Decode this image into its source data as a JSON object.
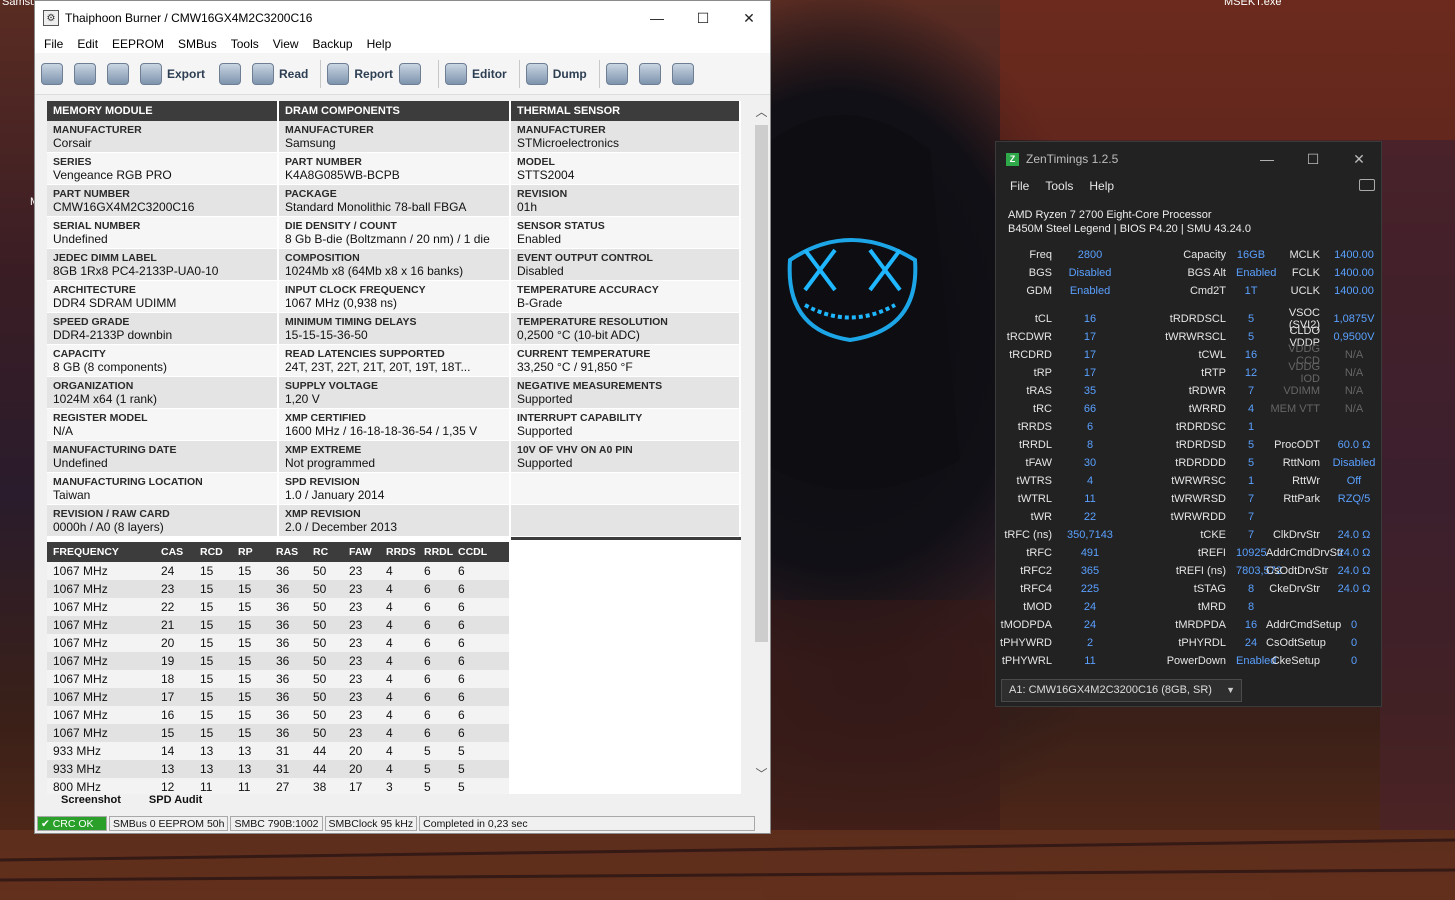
{
  "desktop": {
    "top_left_label": "Samsung Magician",
    "top_right_label": "MSEKT.exe",
    "left_stub_label": "M"
  },
  "thaiphoon": {
    "title": "Thaiphoon Burner / CMW16GX4M2C3200C16",
    "window_buttons": {
      "minimize": "—",
      "maximize": "☐",
      "close": "✕"
    },
    "menu": [
      "File",
      "Edit",
      "EEPROM",
      "SMBus",
      "Tools",
      "View",
      "Backup",
      "Help"
    ],
    "toolbar": {
      "export": "Export",
      "read": "Read",
      "report": "Report",
      "editor": "Editor",
      "dump": "Dump"
    },
    "memory_module": {
      "header": "MEMORY MODULE",
      "items": [
        {
          "label": "MANUFACTURER",
          "value": "Corsair"
        },
        {
          "label": "SERIES",
          "value": "Vengeance RGB PRO"
        },
        {
          "label": "PART NUMBER",
          "value": "CMW16GX4M2C3200C16"
        },
        {
          "label": "SERIAL NUMBER",
          "value": "Undefined"
        },
        {
          "label": "JEDEC DIMM LABEL",
          "value": "8GB 1Rx8 PC4-2133P-UA0-10"
        },
        {
          "label": "ARCHITECTURE",
          "value": "DDR4 SDRAM UDIMM"
        },
        {
          "label": "SPEED GRADE",
          "value": "DDR4-2133P downbin"
        },
        {
          "label": "CAPACITY",
          "value": "8 GB (8 components)"
        },
        {
          "label": "ORGANIZATION",
          "value": "1024M x64 (1 rank)"
        },
        {
          "label": "REGISTER MODEL",
          "value": "N/A"
        },
        {
          "label": "MANUFACTURING DATE",
          "value": "Undefined"
        },
        {
          "label": "MANUFACTURING LOCATION",
          "value": "Taiwan"
        },
        {
          "label": "REVISION / RAW CARD",
          "value": "0000h / A0 (8 layers)"
        }
      ]
    },
    "dram_components": {
      "header": "DRAM COMPONENTS",
      "items": [
        {
          "label": "MANUFACTURER",
          "value": "Samsung"
        },
        {
          "label": "PART NUMBER",
          "value": "K4A8G085WB-BCPB"
        },
        {
          "label": "PACKAGE",
          "value": "Standard Monolithic 78-ball FBGA"
        },
        {
          "label": "DIE DENSITY / COUNT",
          "value": "8 Gb B-die (Boltzmann / 20 nm) / 1 die"
        },
        {
          "label": "COMPOSITION",
          "value": "1024Mb x8 (64Mb x8 x 16 banks)"
        },
        {
          "label": "INPUT CLOCK FREQUENCY",
          "value": "1067 MHz (0,938 ns)"
        },
        {
          "label": "MINIMUM TIMING DELAYS",
          "value": "15-15-15-36-50"
        },
        {
          "label": "READ LATENCIES SUPPORTED",
          "value": "24T, 23T, 22T, 21T, 20T, 19T, 18T..."
        },
        {
          "label": "SUPPLY VOLTAGE",
          "value": "1,20 V"
        },
        {
          "label": "XMP CERTIFIED",
          "value": "1600 MHz / 16-18-18-36-54 / 1,35 V"
        },
        {
          "label": "XMP EXTREME",
          "value": "Not programmed"
        },
        {
          "label": "SPD REVISION",
          "value": "1.0 / January 2014"
        },
        {
          "label": "XMP REVISION",
          "value": "2.0 / December 2013"
        }
      ]
    },
    "thermal_sensor": {
      "header": "THERMAL SENSOR",
      "items": [
        {
          "label": "MANUFACTURER",
          "value": "STMicroelectronics"
        },
        {
          "label": "MODEL",
          "value": "STTS2004"
        },
        {
          "label": "REVISION",
          "value": "01h"
        },
        {
          "label": "SENSOR STATUS",
          "value": "Enabled"
        },
        {
          "label": "EVENT OUTPUT CONTROL",
          "value": "Disabled"
        },
        {
          "label": "TEMPERATURE ACCURACY",
          "value": "B-Grade"
        },
        {
          "label": "TEMPERATURE RESOLUTION",
          "value": "0,2500 °C (10-bit ADC)"
        },
        {
          "label": "CURRENT TEMPERATURE",
          "value": "33,250 °C / 91,850 °F"
        },
        {
          "label": "NEGATIVE MEASUREMENTS",
          "value": "Supported"
        },
        {
          "label": "INTERRUPT CAPABILITY",
          "value": "Supported"
        },
        {
          "label": "10V OF VHV ON A0 PIN",
          "value": "Supported"
        },
        {
          "label": "",
          "value": ""
        },
        {
          "label": "",
          "value": ""
        }
      ]
    },
    "timing_table": {
      "headers": [
        "FREQUENCY",
        "CAS",
        "RCD",
        "RP",
        "RAS",
        "RC",
        "FAW",
        "RRDS",
        "RRDL",
        "CCDL"
      ],
      "rows": [
        [
          "1067 MHz",
          "24",
          "15",
          "15",
          "36",
          "50",
          "23",
          "4",
          "6",
          "6"
        ],
        [
          "1067 MHz",
          "23",
          "15",
          "15",
          "36",
          "50",
          "23",
          "4",
          "6",
          "6"
        ],
        [
          "1067 MHz",
          "22",
          "15",
          "15",
          "36",
          "50",
          "23",
          "4",
          "6",
          "6"
        ],
        [
          "1067 MHz",
          "21",
          "15",
          "15",
          "36",
          "50",
          "23",
          "4",
          "6",
          "6"
        ],
        [
          "1067 MHz",
          "20",
          "15",
          "15",
          "36",
          "50",
          "23",
          "4",
          "6",
          "6"
        ],
        [
          "1067 MHz",
          "19",
          "15",
          "15",
          "36",
          "50",
          "23",
          "4",
          "6",
          "6"
        ],
        [
          "1067 MHz",
          "18",
          "15",
          "15",
          "36",
          "50",
          "23",
          "4",
          "6",
          "6"
        ],
        [
          "1067 MHz",
          "17",
          "15",
          "15",
          "36",
          "50",
          "23",
          "4",
          "6",
          "6"
        ],
        [
          "1067 MHz",
          "16",
          "15",
          "15",
          "36",
          "50",
          "23",
          "4",
          "6",
          "6"
        ],
        [
          "1067 MHz",
          "15",
          "15",
          "15",
          "36",
          "50",
          "23",
          "4",
          "6",
          "6"
        ],
        [
          "933 MHz",
          "14",
          "13",
          "13",
          "31",
          "44",
          "20",
          "4",
          "5",
          "5"
        ],
        [
          "933 MHz",
          "13",
          "13",
          "13",
          "31",
          "44",
          "20",
          "4",
          "5",
          "5"
        ],
        [
          "800 MHz",
          "12",
          "11",
          "11",
          "27",
          "38",
          "17",
          "3",
          "5",
          "5"
        ]
      ]
    },
    "bottom_buttons": {
      "screenshot": "Screenshot",
      "spd_audit": "SPD Audit"
    },
    "status": {
      "crc": "✔ CRC OK",
      "smbus": "SMBus 0 EEPROM 50h",
      "smbc": "SMBC 790B:1002",
      "smbclock": "SMBClock 95 kHz",
      "completed": "Completed in 0,23 sec"
    },
    "colors": {
      "header_bg": "#3c3c3c",
      "crc_ok": "#2aa02a"
    }
  },
  "zentimings": {
    "title": "ZenTimings 1.2.5",
    "window_buttons": {
      "minimize": "—",
      "maximize": "☐",
      "close": "✕"
    },
    "menu": [
      "File",
      "Tools",
      "Help"
    ],
    "cpu": "AMD Ryzen 7 2700 Eight-Core Processor",
    "board": "B450M Steel Legend | BIOS P4.20 | SMU 43.24.0",
    "group1": [
      [
        "Freq",
        "2800",
        "Capacity",
        "16GB",
        "MCLK",
        "1400.00"
      ],
      [
        "BGS",
        "Disabled",
        "BGS Alt",
        "Enabled",
        "FCLK",
        "1400.00"
      ],
      [
        "GDM",
        "Enabled",
        "Cmd2T",
        "1T",
        "UCLK",
        "1400.00"
      ]
    ],
    "group2": [
      [
        "tCL",
        "16",
        "tRDRDSCL",
        "5",
        "VSOC (SVI2)",
        "1,0875V"
      ],
      [
        "tRCDWR",
        "17",
        "tWRWRSCL",
        "5",
        "CLDO VDDP",
        "0,9500V"
      ],
      [
        "tRCDRD",
        "17",
        "tCWL",
        "16",
        "VDDG CCD",
        "N/A"
      ],
      [
        "tRP",
        "17",
        "tRTP",
        "12",
        "VDDG IOD",
        "N/A"
      ],
      [
        "tRAS",
        "35",
        "tRDWR",
        "7",
        "VDIMM",
        "N/A"
      ],
      [
        "tRC",
        "66",
        "tWRRD",
        "4",
        "MEM VTT",
        "N/A"
      ],
      [
        "tRRDS",
        "6",
        "tRDRDSC",
        "1",
        "",
        ""
      ],
      [
        "tRRDL",
        "8",
        "tRDRDSD",
        "5",
        "ProcODT",
        "60.0 Ω"
      ],
      [
        "tFAW",
        "30",
        "tRDRDDD",
        "5",
        "RttNom",
        "Disabled"
      ],
      [
        "tWTRS",
        "4",
        "tWRWRSC",
        "1",
        "RttWr",
        "Off"
      ],
      [
        "tWTRL",
        "11",
        "tWRWRSD",
        "7",
        "RttPark",
        "RZQ/5"
      ],
      [
        "tWR",
        "22",
        "tWRWRDD",
        "7",
        "",
        ""
      ],
      [
        "tRFC (ns)",
        "350,7143",
        "tCKE",
        "7",
        "ClkDrvStr",
        "24.0 Ω"
      ],
      [
        "tRFC",
        "491",
        "tREFI",
        "10925",
        "AddrCmdDrvStr",
        "24.0 Ω"
      ],
      [
        "tRFC2",
        "365",
        "tREFI (ns)",
        "7803,572",
        "CsOdtDrvStr",
        "24.0 Ω"
      ],
      [
        "tRFC4",
        "225",
        "tSTAG",
        "8",
        "CkeDrvStr",
        "24.0 Ω"
      ],
      [
        "tMOD",
        "24",
        "tMRD",
        "8",
        "",
        ""
      ],
      [
        "tMODPDA",
        "24",
        "tMRDPDA",
        "16",
        "AddrCmdSetup",
        "0"
      ],
      [
        "tPHYWRD",
        "2",
        "tPHYRDL",
        "24",
        "CsOdtSetup",
        "0"
      ],
      [
        "tPHYWRL",
        "11",
        "PowerDown",
        "Enabled",
        "CkeSetup",
        "0"
      ]
    ],
    "dimmed_labels": [
      "VDDG CCD",
      "VDDG IOD",
      "VDIMM",
      "MEM VTT"
    ],
    "module_select": "A1: CMW16GX4M2C3200C16 (8GB, SR)",
    "colors": {
      "value": "#5aa0ff",
      "bg": "#222222"
    }
  }
}
